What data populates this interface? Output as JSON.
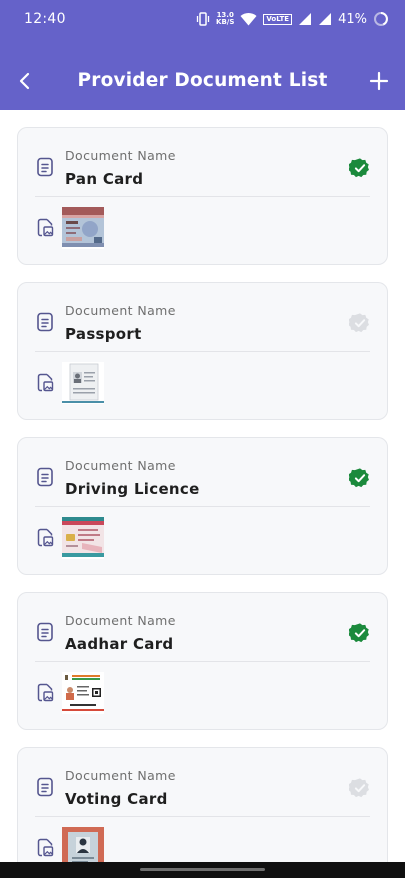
{
  "status_bar": {
    "time": "12:40",
    "speed_value": "13.0",
    "speed_unit": "KB/S",
    "volte": "VoLTE",
    "battery": "41%"
  },
  "header": {
    "title": "Provider Document List",
    "back_icon": "back-arrow-icon",
    "add_icon": "plus-icon",
    "background": "#6562c9"
  },
  "colors": {
    "accent": "#6562c9",
    "verified": "#1b8a3c",
    "unverified": "#dcdee2"
  },
  "document_label": "Document Name",
  "documents": [
    {
      "name": "Pan Card",
      "verified": true,
      "thumb": "pan-card-thumbnail"
    },
    {
      "name": "Passport",
      "verified": false,
      "thumb": "passport-thumbnail"
    },
    {
      "name": "Driving Licence",
      "verified": true,
      "thumb": "driving-licence-thumbnail"
    },
    {
      "name": "Aadhar Card",
      "verified": true,
      "thumb": "aadhar-card-thumbnail"
    },
    {
      "name": "Voting Card",
      "verified": false,
      "thumb": "voting-card-thumbnail"
    }
  ]
}
